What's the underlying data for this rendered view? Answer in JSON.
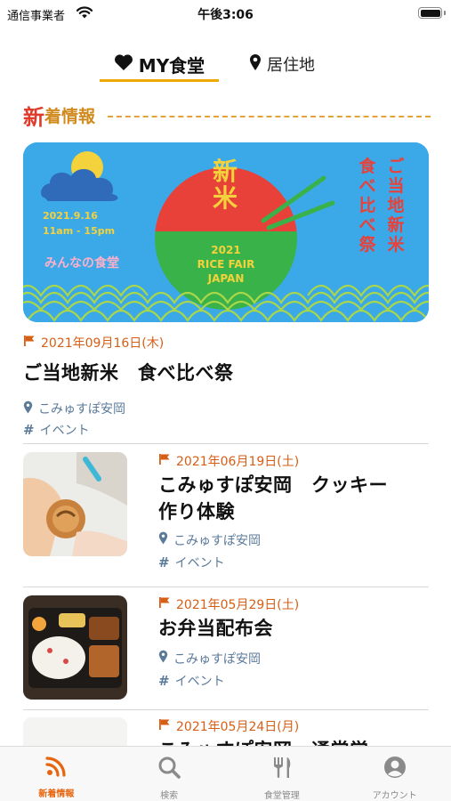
{
  "status_bar": {
    "carrier": "通信事業者",
    "time": "午後3:06",
    "wifi_icon": "wifi-icon",
    "battery_icon": "battery-icon"
  },
  "top_tabs": [
    {
      "label": "MY食堂",
      "icon": "heart-icon",
      "selected": true
    },
    {
      "label": "居住地",
      "icon": "map-pin-icon",
      "selected": false
    }
  ],
  "section": {
    "title_first": "新",
    "title_rest": "着情報"
  },
  "banner": {
    "new_rice": "新米",
    "event_date": "2021.9.16",
    "event_time": "11am - 15pm",
    "fair_year": "2021",
    "fair_name_1": "RICE FAIR",
    "fair_name_2": "JAPAN",
    "vertical_right": "ご当地新米",
    "vertical_left": "食べ比べ祭",
    "logo": "みんなの食堂"
  },
  "featured": {
    "date": "2021年09月16日(木)",
    "title": "ご当地新米　食べ比べ祭",
    "place": "こみゅすぽ安岡",
    "tag": "イベント"
  },
  "items": [
    {
      "date": "2021年06月19日(土)",
      "title_line1": "こみゅすぽ安岡　クッキー",
      "title_line2": "作り体験",
      "place": "こみゅすぽ安岡",
      "tag": "イベント"
    },
    {
      "date": "2021年05月29日(土)",
      "title_line1": "お弁当配布会",
      "place": "こみゅすぽ安岡",
      "tag": "イベント"
    },
    {
      "date": "2021年05月24日(月)",
      "title_line1": "こみゅすぽ安岡　通常営"
    }
  ],
  "bottom_nav": [
    {
      "label": "新着情報",
      "icon": "rss-icon",
      "active": true
    },
    {
      "label": "検索",
      "icon": "search-icon",
      "active": false
    },
    {
      "label": "食堂管理",
      "icon": "fork-knife-icon",
      "active": false
    },
    {
      "label": "アカウント",
      "icon": "account-icon",
      "active": false
    }
  ],
  "colors": {
    "accent": "#e8650f",
    "tab_underline": "#f0a800",
    "section_red": "#e03a2a",
    "section_orange": "#d08a1e",
    "meta_blue": "#5b7a9a"
  }
}
